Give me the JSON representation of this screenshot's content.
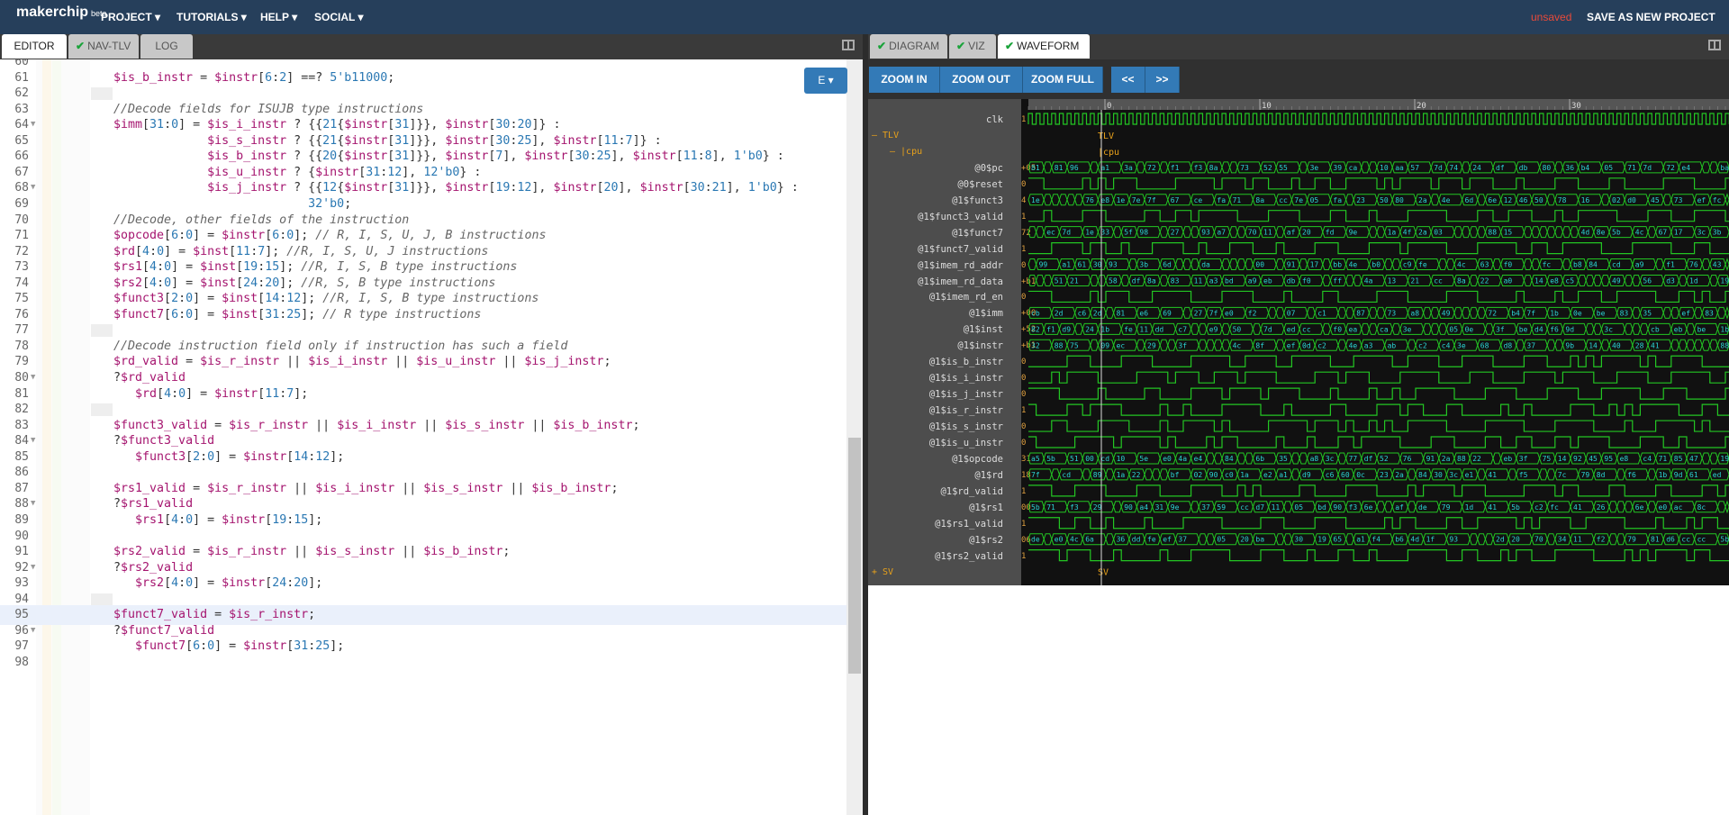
{
  "app": {
    "logo": "makerchip",
    "beta": "beta",
    "menus": [
      "PROJECT ▾",
      "TUTORIALS ▾",
      "HELP ▾",
      "SOCIAL ▾"
    ],
    "unsaved": "unsaved",
    "save_as": "SAVE AS NEW PROJECT"
  },
  "left_tabs": [
    {
      "label": "EDITOR",
      "active": true,
      "check": false
    },
    {
      "label": "NAV-TLV",
      "active": false,
      "check": true
    },
    {
      "label": "LOG",
      "active": false,
      "check": false
    }
  ],
  "right_tabs": [
    {
      "label": "DIAGRAM",
      "active": false,
      "check": true
    },
    {
      "label": "VIZ",
      "active": false,
      "check": true
    },
    {
      "label": "WAVEFORM",
      "active": true,
      "check": true
    }
  ],
  "editor": {
    "e_button": "E ▾",
    "lines": [
      {
        "n": "60",
        "t": "",
        "blank": false,
        "fold": false
      },
      {
        "n": "61",
        "t": "$is_b_instr = $instr[6:2] ==? 5'b11000;"
      },
      {
        "n": "62",
        "t": "",
        "blank": true
      },
      {
        "n": "63",
        "t": "//Decode fields for ISUJB type instructions"
      },
      {
        "n": "64",
        "t": "$imm[31:0] = $is_i_instr ? {{21{$instr[31]}}, $instr[30:20]} :",
        "fold": true
      },
      {
        "n": "65",
        "t": "             $is_s_instr ? {{21{$instr[31]}}, $instr[30:25], $instr[11:7]} :"
      },
      {
        "n": "66",
        "t": "             $is_b_instr ? {{20{$instr[31]}}, $instr[7], $instr[30:25], $instr[11:8], 1'b0} :"
      },
      {
        "n": "67",
        "t": "             $is_u_instr ? {$instr[31:12], 12'b0} :"
      },
      {
        "n": "68",
        "t": "             $is_j_instr ? {{12{$instr[31]}}, $instr[19:12], $instr[20], $instr[30:21], 1'b0} :",
        "fold": true
      },
      {
        "n": "69",
        "t": "                           32'b0;"
      },
      {
        "n": "70",
        "t": "//Decode, other fields of the instruction"
      },
      {
        "n": "71",
        "t": "$opcode[6:0] = $instr[6:0]; // R, I, S, U, J, B instructions"
      },
      {
        "n": "72",
        "t": "$rd[4:0] = $inst[11:7]; //R, I, S, U, J instructions"
      },
      {
        "n": "73",
        "t": "$rs1[4:0] = $inst[19:15]; //R, I, S, B type instructions"
      },
      {
        "n": "74",
        "t": "$rs2[4:0] = $inst[24:20]; //R, S, B type instructions"
      },
      {
        "n": "75",
        "t": "$funct3[2:0] = $inst[14:12]; //R, I, S, B type instructions"
      },
      {
        "n": "76",
        "t": "$funct7[6:0] = $inst[31:25]; // R type instructions"
      },
      {
        "n": "77",
        "t": "",
        "blank": true
      },
      {
        "n": "78",
        "t": "//Decode instruction field only if instruction has such a field"
      },
      {
        "n": "79",
        "t": "$rd_valid = $is_r_instr || $is_i_instr || $is_u_instr || $is_j_instr;"
      },
      {
        "n": "80",
        "t": "?$rd_valid",
        "fold": true
      },
      {
        "n": "81",
        "t": "   $rd[4:0] = $instr[11:7];"
      },
      {
        "n": "82",
        "t": "",
        "blank": true
      },
      {
        "n": "83",
        "t": "$funct3_valid = $is_r_instr || $is_i_instr || $is_s_instr || $is_b_instr;"
      },
      {
        "n": "84",
        "t": "?$funct3_valid",
        "fold": true
      },
      {
        "n": "85",
        "t": "   $funct3[2:0] = $instr[14:12];"
      },
      {
        "n": "86",
        "t": ""
      },
      {
        "n": "87",
        "t": "$rs1_valid = $is_r_instr || $is_i_instr || $is_s_instr || $is_b_instr;"
      },
      {
        "n": "88",
        "t": "?$rs1_valid",
        "fold": true
      },
      {
        "n": "89",
        "t": "   $rs1[4:0] = $instr[19:15];"
      },
      {
        "n": "90",
        "t": ""
      },
      {
        "n": "91",
        "t": "$rs2_valid = $is_r_instr || $is_s_instr || $is_b_instr;"
      },
      {
        "n": "92",
        "t": "?$rs2_valid",
        "fold": true
      },
      {
        "n": "93",
        "t": "   $rs2[4:0] = $instr[24:20];"
      },
      {
        "n": "94",
        "t": "",
        "blank": true
      },
      {
        "n": "95",
        "t": "$funct7_valid = $is_r_instr;",
        "cur": true
      },
      {
        "n": "96",
        "t": "?$funct7_valid",
        "fold": true
      },
      {
        "n": "97",
        "t": "   $funct7[6:0] = $instr[31:25];"
      },
      {
        "n": "98",
        "t": ""
      }
    ]
  },
  "waveform": {
    "buttons": [
      "ZOOM IN",
      "ZOOM OUT",
      "ZOOM FULL",
      "<<",
      ">>"
    ],
    "ticks": [
      "0",
      "10",
      "20",
      "30"
    ],
    "scopes": {
      "tlv": "TLV",
      "cpu": "|cpu",
      "sv": "SV"
    },
    "signals": [
      {
        "name": "clk",
        "val": "1",
        "kind": "clk"
      },
      {
        "name": "",
        "val": "",
        "kind": "tlv"
      },
      {
        "name": "",
        "val": "",
        "kind": "cpu"
      },
      {
        "name": "@0$pc",
        "val": "+05",
        "kind": "bus"
      },
      {
        "name": "@0$reset",
        "val": "0",
        "kind": "bit"
      },
      {
        "name": "@1$funct3",
        "val": "4",
        "kind": "bus"
      },
      {
        "name": "@1$funct3_valid",
        "val": "1",
        "kind": "bit"
      },
      {
        "name": "@1$funct7",
        "val": "72",
        "kind": "bus"
      },
      {
        "name": "@1$funct7_valid",
        "val": "1",
        "kind": "bit"
      },
      {
        "name": "@1$imem_rd_addr",
        "val": "0",
        "kind": "bus"
      },
      {
        "name": "@1$imem_rd_data",
        "val": "+b1",
        "kind": "bus"
      },
      {
        "name": "@1$imem_rd_en",
        "val": "0",
        "kind": "bit"
      },
      {
        "name": "@1$imm",
        "val": "+00",
        "kind": "bus"
      },
      {
        "name": "@1$inst",
        "val": "+52",
        "kind": "bus"
      },
      {
        "name": "@1$instr",
        "val": "+b1",
        "kind": "bus"
      },
      {
        "name": "@1$is_b_instr",
        "val": "0",
        "kind": "bit"
      },
      {
        "name": "@1$is_i_instr",
        "val": "0",
        "kind": "bit"
      },
      {
        "name": "@1$is_j_instr",
        "val": "0",
        "kind": "bit"
      },
      {
        "name": "@1$is_r_instr",
        "val": "1",
        "kind": "bit"
      },
      {
        "name": "@1$is_s_instr",
        "val": "0",
        "kind": "bit"
      },
      {
        "name": "@1$is_u_instr",
        "val": "0",
        "kind": "bit"
      },
      {
        "name": "@1$opcode",
        "val": "31",
        "kind": "bus"
      },
      {
        "name": "@1$rd",
        "val": "18",
        "kind": "bus"
      },
      {
        "name": "@1$rd_valid",
        "val": "1",
        "kind": "bit"
      },
      {
        "name": "@1$rs1",
        "val": "00",
        "kind": "bus"
      },
      {
        "name": "@1$rs1_valid",
        "val": "1",
        "kind": "bit"
      },
      {
        "name": "@1$rs2",
        "val": "06",
        "kind": "bus"
      },
      {
        "name": "@1$rs2_valid",
        "val": "1",
        "kind": "bit"
      },
      {
        "name": "",
        "val": "",
        "kind": "sv"
      }
    ]
  },
  "colors": {
    "topbar": "#263f5b",
    "accent": "#337ab7",
    "wave_green": "#23c623",
    "wave_bg": "#111111",
    "bus_text": "#2bd4d4",
    "scope": "#e9a21b",
    "unsaved": "#e84a3a"
  }
}
